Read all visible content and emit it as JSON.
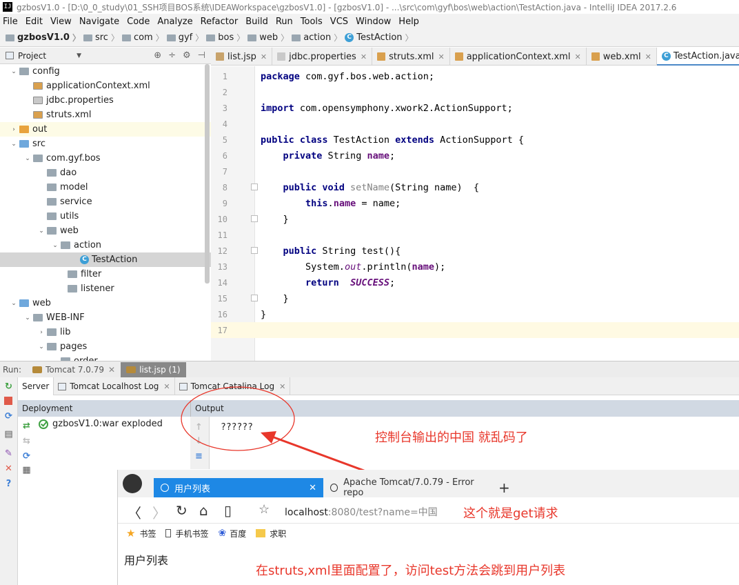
{
  "window": {
    "title": "gzbosV1.0 - [D:\\0_0_study\\01_SSH项目BOS系统\\IDEAWorkspace\\gzbosV1.0] - [gzbosV1.0] - ...\\src\\com\\gyf\\bos\\web\\action\\TestAction.java - IntelliJ IDEA 2017.2.6"
  },
  "menu": [
    "File",
    "Edit",
    "View",
    "Navigate",
    "Code",
    "Analyze",
    "Refactor",
    "Build",
    "Run",
    "Tools",
    "VCS",
    "Window",
    "Help"
  ],
  "breadcrumb": [
    "gzbosV1.0",
    "src",
    "com",
    "gyf",
    "bos",
    "web",
    "action",
    "TestAction"
  ],
  "project_panel": {
    "title": "Project",
    "tree": [
      {
        "label": "config",
        "icon": "folder-icon"
      },
      {
        "label": "applicationContext.xml",
        "icon": "xml-file-icon"
      },
      {
        "label": "jdbc.properties",
        "icon": "properties-file-icon"
      },
      {
        "label": "struts.xml",
        "icon": "xml-file-icon"
      },
      {
        "label": "out",
        "icon": "folder-icon"
      },
      {
        "label": "src",
        "icon": "folder-icon"
      },
      {
        "label": "com.gyf.bos",
        "icon": "package-icon"
      },
      {
        "label": "dao",
        "icon": "package-icon"
      },
      {
        "label": "model",
        "icon": "package-icon"
      },
      {
        "label": "service",
        "icon": "package-icon"
      },
      {
        "label": "utils",
        "icon": "package-icon"
      },
      {
        "label": "web",
        "icon": "package-icon"
      },
      {
        "label": "action",
        "icon": "package-icon"
      },
      {
        "label": "TestAction",
        "icon": "class-icon"
      },
      {
        "label": "filter",
        "icon": "package-icon"
      },
      {
        "label": "listener",
        "icon": "package-icon"
      },
      {
        "label": "web",
        "icon": "folder-icon"
      },
      {
        "label": "WEB-INF",
        "icon": "folder-icon"
      },
      {
        "label": "lib",
        "icon": "folder-icon"
      },
      {
        "label": "pages",
        "icon": "folder-icon"
      },
      {
        "label": "order",
        "icon": "folder-icon"
      }
    ]
  },
  "editor_tabs": [
    "list.jsp",
    "jdbc.properties",
    "struts.xml",
    "applicationContext.xml",
    "web.xml",
    "TestAction.java"
  ],
  "code": {
    "line_numbers": [
      "1",
      "2",
      "3",
      "4",
      "5",
      "6",
      "7",
      "8",
      "9",
      "10",
      "11",
      "12",
      "13",
      "14",
      "15",
      "16",
      "17"
    ],
    "l1_kw": "package",
    "l1_rest": " com.gyf.bos.web.action;",
    "l3_kw": "import",
    "l3_rest": " com.opensymphony.xwork2.ActionSupport;",
    "l5_kw1": "public class",
    "l5_mid": " TestAction ",
    "l5_kw2": "extends",
    "l5_rest": " ActionSupport {",
    "l6_kw": "private",
    "l6_mid": " String ",
    "l6_fld": "name",
    "l6_rest": ";",
    "l8_kw": "public void",
    "l8_meth": " setName",
    "l8_rest": "(String name)  {",
    "l9_kw": "this",
    "l9_dot": ".",
    "l9_fld": "name",
    "l9_rest": " = name;",
    "l10": "}",
    "l12_kw": "public",
    "l12_rest": " String test(){",
    "l13_pre": "System.",
    "l13_out": "out",
    "l13_mid": ".println(",
    "l13_fld": "name",
    "l13_rest": ");",
    "l14_kw": "return",
    "l14_gap": "  ",
    "l14_stat": "SUCCESS",
    "l14_rest": ";",
    "l15": "}",
    "l16": "}"
  },
  "run_panel": {
    "label": "Run:",
    "tabs": [
      "Tomcat 7.0.79",
      "list.jsp (1)"
    ],
    "server_tabs": [
      "Server",
      "Tomcat Localhost Log",
      "Tomcat Catalina Log"
    ],
    "deployment_header": "Deployment",
    "output_header": "Output",
    "deployment_item": "gzbosV1.0:war exploded",
    "output_text": "??????"
  },
  "annotations": {
    "console": "控制台输出的中国   就乱码了",
    "get": "这个就是get请求",
    "struts": "在struts,xml里面配置了，访问test方法会跳到用户列表"
  },
  "browser": {
    "tab_active": "用户列表",
    "tab_inactive": "Apache Tomcat/7.0.79 - Error repo",
    "url_host": "localhost",
    "url_port": ":8080",
    "url_path": "/test?name=中国",
    "bookmarks": [
      "书签",
      "手机书签",
      "百度",
      "求职"
    ],
    "page_text": "用户列表"
  },
  "colors": {
    "annotation": "#e8372b",
    "browser_tab": "#1e88e5"
  }
}
